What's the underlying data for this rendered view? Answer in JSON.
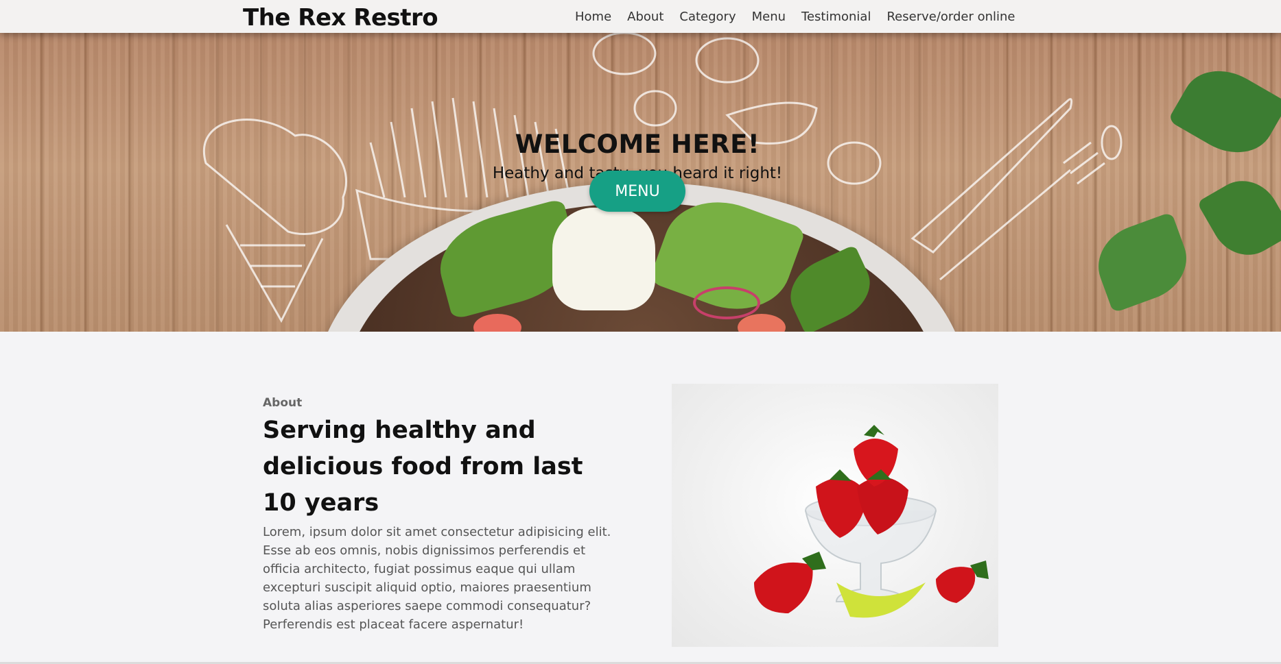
{
  "brand": {
    "name": "The Rex Restro"
  },
  "nav": [
    {
      "label": "Home"
    },
    {
      "label": "About"
    },
    {
      "label": "Category"
    },
    {
      "label": "Menu"
    },
    {
      "label": "Testimonial"
    },
    {
      "label": "Reserve/order online"
    }
  ],
  "hero": {
    "title": "WELCOME HERE!",
    "subtitle": "Heathy and tasty, you heard it right!",
    "button_label": "MENU",
    "button_color": "#16a085"
  },
  "about": {
    "label": "About",
    "heading": "Serving healthy and delicious food from last 10 years",
    "text": "Lorem, ipsum dolor sit amet consectetur adipisicing elit. Esse ab eos omnis, nobis dignissimos perferendis et officia architecto, fugiat possimus eaque qui ullam excepturi suscipit aliquid optio, maiores praesentium soluta alias asperiores saepe commodi consequatur? Perferendis est placeat facere aspernatur!"
  }
}
